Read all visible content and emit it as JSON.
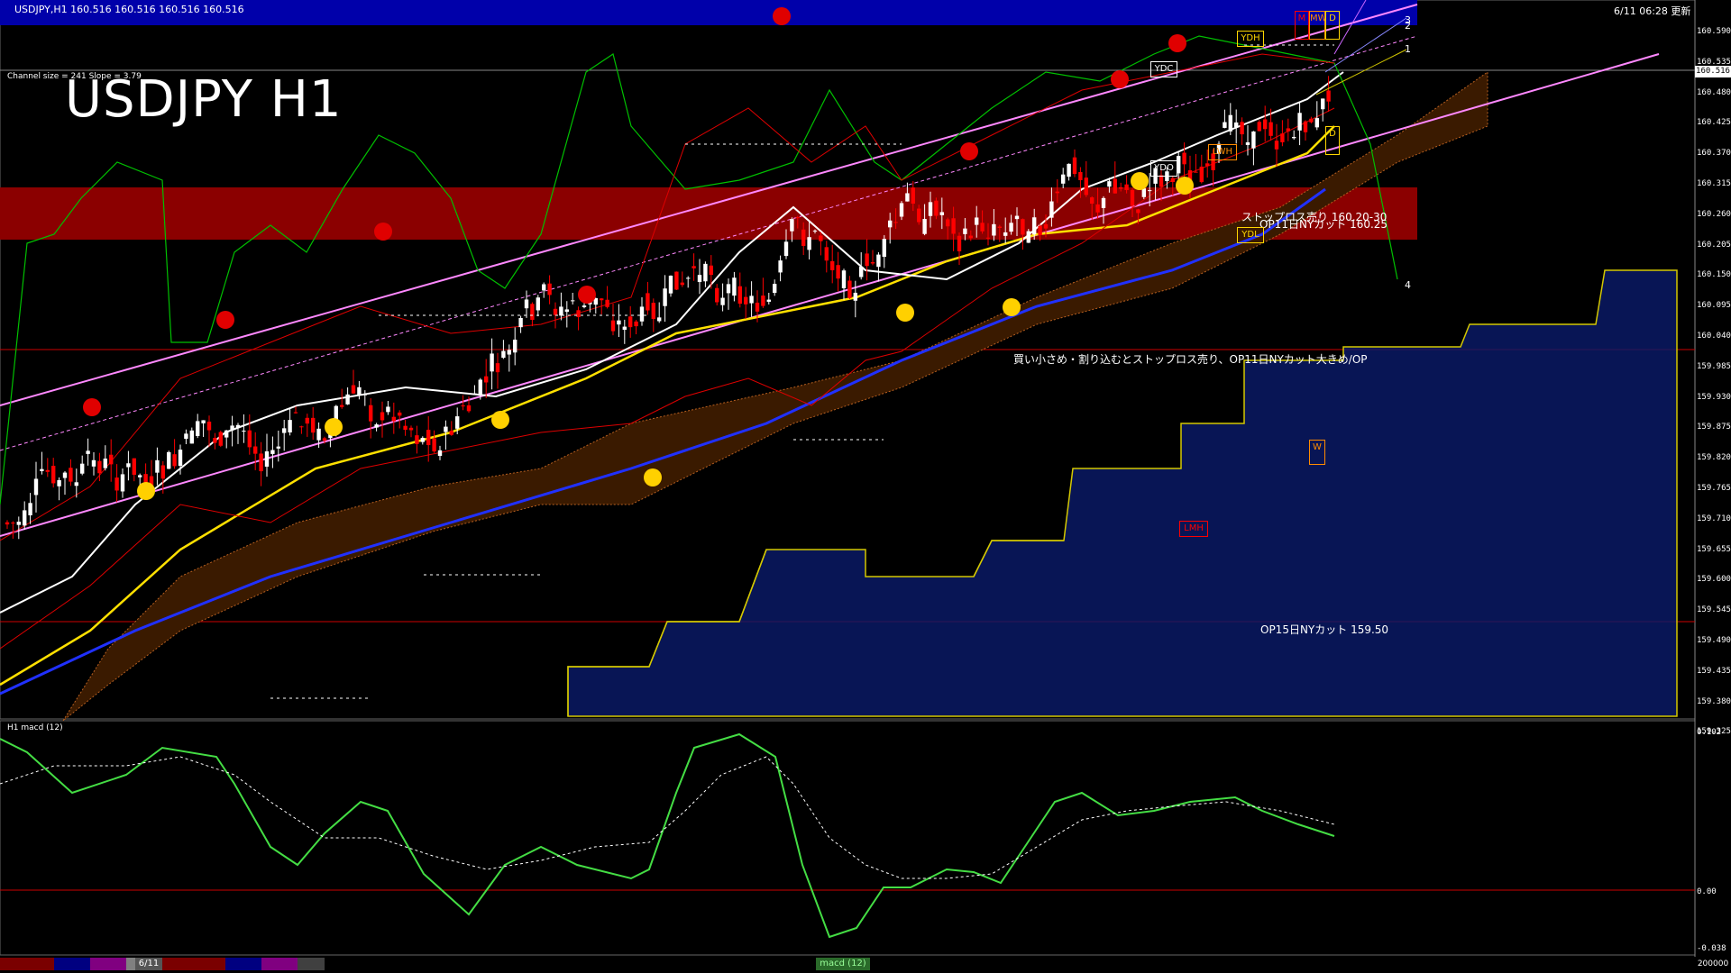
{
  "window": {
    "chart_title": "USDJPY,H1  160.516 160.516 160.516 160.516",
    "big_title": "USDJPY H1",
    "channel_info": "Channel size = 241 Slope = 3.79",
    "datetime_label": "6/11 06:28 更新",
    "macd_label": "H1  macd (12)"
  },
  "price_axis": {
    "labels": [
      "160.590",
      "160.535",
      "160.480",
      "160.425",
      "160.370",
      "160.315",
      "160.260",
      "160.205",
      "160.150",
      "160.095",
      "160.040",
      "159.985",
      "159.930",
      "159.875",
      "159.820",
      "159.765",
      "159.710",
      "159.655",
      "159.600",
      "159.545",
      "159.490",
      "159.435",
      "159.380",
      "159.325"
    ],
    "current": "160.516"
  },
  "macd_axis": {
    "labels": [
      "0.102",
      "0.00",
      "-0.038"
    ]
  },
  "annotations": {
    "stop_loss_sell": "ストップロス売り 160.20-30",
    "op_cut_160": "OP11日NYカット 160.25",
    "comment": "買い小さめ・割り込むとストップロス売り、OP11日NYカット大きめ/OP",
    "op_cut_159": "OP15日NYカット 159.50"
  },
  "box_labels": {
    "ydh": "YDH",
    "ydc": "YDC",
    "ydo": "YDO",
    "ydl": "YDL",
    "lwh": "LWH",
    "lmh": "LMH",
    "w": "W",
    "d": "D",
    "m": "M",
    "mw": "MW",
    "d2": "D"
  },
  "line_numbers": {
    "n1": "1",
    "n2": "2",
    "n3": "3",
    "n4": "4"
  },
  "bottom_bar": {
    "date_tab": "6/11",
    "macd_tab": "macd (12)",
    "right_value": "200000"
  },
  "colors": {
    "background": "#000000",
    "bullish_candle": "#ffffff",
    "bearish_candle": "#ff0000",
    "header_band": "#0000aa",
    "resistance_band": "#8b0000",
    "trendline": "#ff88ff",
    "macd_up": "#44dd44",
    "macd_down": "#ff88aa"
  }
}
